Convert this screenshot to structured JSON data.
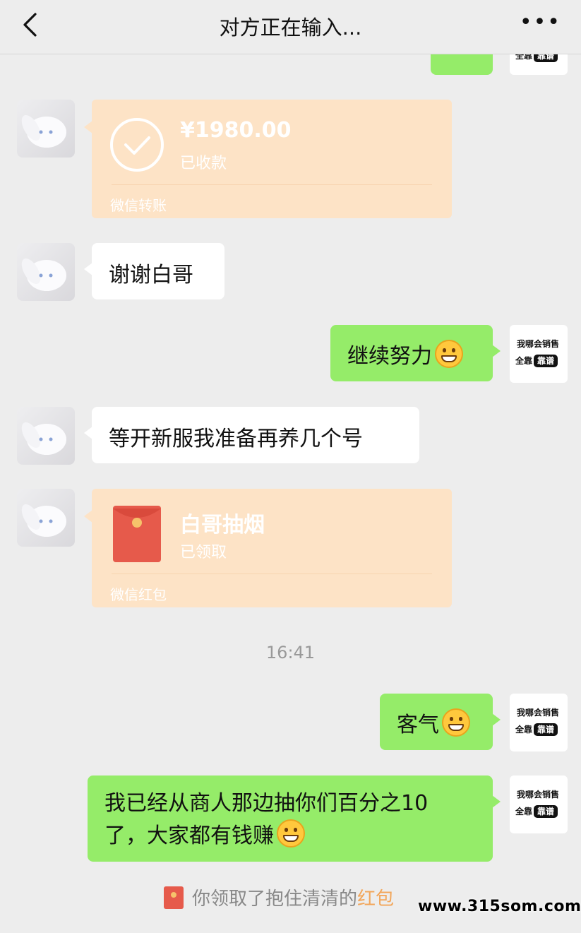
{
  "header": {
    "title": "对方正在输入...",
    "back_icon": "chevron-left-icon",
    "more_icon": "more-dots-icon",
    "more_label": "•••"
  },
  "sticker": {
    "line1": "我哪会销售",
    "line2_prefix": "全靠",
    "line2_tag": "靠谱"
  },
  "transfer": {
    "amount": "¥1980.00",
    "status": "已收款",
    "footer": "微信转账"
  },
  "messages": {
    "m1": "谢谢白哥",
    "m2": "继续努力",
    "m3": "等开新服我准备再养几个号",
    "m4": "客气",
    "m5_line1": "我已经从商人那边抽你们百分之10",
    "m5_line2": "了，大家都有钱赚"
  },
  "red_packet": {
    "title": "白哥抽烟",
    "status": "已领取",
    "footer": "微信红包"
  },
  "time_divider": "16:41",
  "system_notice": {
    "text": "你领取了抱住清清的",
    "link": "红包"
  },
  "watermark": "www.315som.com",
  "colors": {
    "background": "#ededed",
    "green_bubble": "#95ec69",
    "card": "#fde3c6",
    "red_packet": "#e65a4b"
  }
}
